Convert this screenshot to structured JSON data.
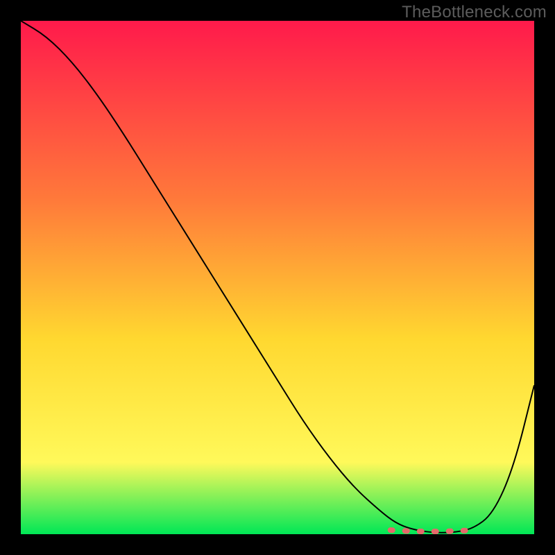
{
  "watermark": "TheBottleneck.com",
  "colors": {
    "background": "#000000",
    "watermark_text": "#5c5c5c",
    "gradient_top": "#ff1a4b",
    "gradient_mid_upper": "#ff7a3a",
    "gradient_mid": "#ffd830",
    "gradient_mid_lower": "#fff95a",
    "gradient_bottom": "#00e756",
    "curve_stroke": "#000000",
    "highlight_stroke": "#e46a6a"
  },
  "chart_data": {
    "type": "line",
    "title": "",
    "xlabel": "",
    "ylabel": "",
    "xlim": [
      0,
      100
    ],
    "ylim": [
      0,
      100
    ],
    "x": [
      0,
      5,
      10,
      15,
      20,
      25,
      30,
      35,
      40,
      45,
      50,
      55,
      60,
      65,
      70,
      73,
      76,
      80,
      84,
      88,
      92,
      96,
      100
    ],
    "values": [
      100,
      97,
      92,
      85.5,
      78,
      70,
      62,
      54,
      46,
      38,
      30,
      22,
      15,
      9,
      4.5,
      2.2,
      1.0,
      0.3,
      0.3,
      1.0,
      4,
      13,
      29
    ],
    "highlight_range_x": [
      72,
      88
    ],
    "highlight_y": 0.8,
    "grid": false,
    "legend": false
  }
}
